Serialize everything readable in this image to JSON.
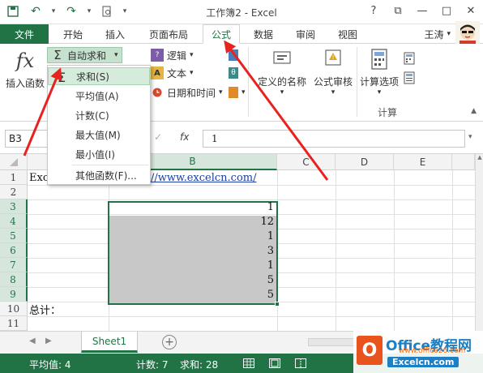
{
  "window": {
    "title": "工作簿2 - Excel",
    "help": "?",
    "ctrl_restore": "⧉",
    "ctrl_min": "—",
    "ctrl_max": "□",
    "ctrl_close": "✕"
  },
  "qat": {
    "save": "💾",
    "undo": "↶",
    "redo": "↷",
    "preview": "🔍",
    "more": "▾"
  },
  "tabs": {
    "file": "文件",
    "home": "开始",
    "insert": "插入",
    "page_layout": "页面布局",
    "formulas": "公式",
    "data": "数据",
    "review": "审阅",
    "view": "视图",
    "active": "公式"
  },
  "user": {
    "name": "王涛",
    "dropdown": "▾"
  },
  "ribbon": {
    "insert_function_label": "插入函数",
    "fx_symbol": "fx",
    "autosum_label": "自动求和",
    "logic_label": "逻辑",
    "text_label": "文本",
    "datetime_label": "日期和时间",
    "defined_names_label": "定义的名称",
    "formula_audit_label": "公式审核",
    "calc_options_label": "计算选项",
    "calc_group_label": "计算",
    "dropdown_arrow": "▾"
  },
  "autosum_menu": {
    "sum": "求和(S)",
    "average": "平均值(A)",
    "count": "计数(C)",
    "max": "最大值(M)",
    "min": "最小值(I)",
    "more": "其他函数(F)...",
    "sigma": "Σ"
  },
  "formula_bar": {
    "name_box": "B3",
    "name_dropdown": "▾",
    "cancel": "✕",
    "confirm": "✓",
    "fx": "fx",
    "value": "1",
    "expand": "▾"
  },
  "grid": {
    "columns": [
      "B",
      "C",
      "D",
      "E"
    ],
    "rows": [
      "1",
      "2",
      "3",
      "4",
      "5",
      "6",
      "7",
      "8",
      "9",
      "10",
      "11"
    ],
    "a1": "Exc",
    "b1": "//www.excelcn.com/",
    "a10": "总计：",
    "b_values": [
      "1",
      "12",
      "1",
      "3",
      "1",
      "5",
      "5"
    ]
  },
  "sheet_bar": {
    "sheet1": "Sheet1",
    "prev": "◀",
    "next": "▶",
    "add": "+"
  },
  "status_bar": {
    "average": "平均值: 4",
    "count": "计数: 7",
    "sum": "求和: 28"
  },
  "logo": {
    "mark": "O",
    "main": "Office教程网",
    "url": "www.office26.com",
    "sub": "Excelcn.com"
  },
  "colors": {
    "excel_green": "#217346",
    "selection_fill": "#c8c8c8",
    "menu_highlight": "#d5ebdc",
    "arrow_red": "#e8231f"
  }
}
